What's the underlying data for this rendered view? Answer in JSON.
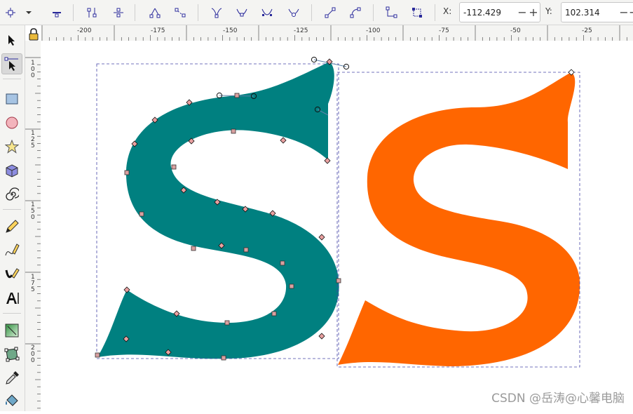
{
  "toolbar": {
    "x_label": "X:",
    "x_value": "-112.429",
    "y_label": "Y:",
    "y_value": "102.314",
    "stepper_minus": "−",
    "stepper_plus": "+"
  },
  "ruler": {
    "h_ticks": [
      "-200",
      "-175",
      "-150",
      "-125",
      "-100",
      "-75",
      "-50",
      "-25"
    ],
    "v_ticks": [
      [
        "1",
        "0",
        "0"
      ],
      [
        "1",
        "2",
        "5"
      ],
      [
        "1",
        "5",
        "0"
      ],
      [
        "1",
        "7",
        "5"
      ],
      [
        "2",
        "0",
        "0"
      ]
    ]
  },
  "canvas": {
    "shape_1_color": "#008080",
    "shape_2_color": "#ff6600"
  },
  "watermark": "CSDN @岳涛@心馨电脑"
}
